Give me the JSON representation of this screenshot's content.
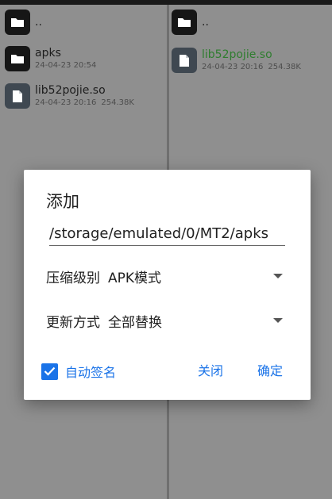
{
  "left_pane": {
    "items": [
      {
        "name": "..",
        "type": "folder",
        "date": "",
        "size": ""
      },
      {
        "name": "apks",
        "type": "folder",
        "date": "24-04-23 20:54",
        "size": ""
      },
      {
        "name": "lib52pojie.so",
        "type": "file",
        "date": "24-04-23 20:16",
        "size": "254.38K"
      }
    ]
  },
  "right_pane": {
    "items": [
      {
        "name": "..",
        "type": "folder",
        "date": "",
        "size": ""
      },
      {
        "name": "lib52pojie.so",
        "type": "file",
        "date": "24-04-23 20:16",
        "size": "254.38K"
      }
    ]
  },
  "dialog": {
    "title": "添加",
    "path_value": "/storage/emulated/0/MT2/apks",
    "compression": {
      "label": "压缩级别",
      "value": "APK模式"
    },
    "update_mode": {
      "label": "更新方式",
      "value": "全部替换"
    },
    "auto_sign": {
      "label": "自动签名",
      "checked": true
    },
    "close_label": "关闭",
    "confirm_label": "确定"
  },
  "colors": {
    "accent": "#1a73e8",
    "highlight_file": "#2f7d2f"
  },
  "icons": {
    "folder": "folder-icon",
    "file": "file-icon",
    "dropdown": "dropdown-arrow-icon",
    "check": "check-icon"
  }
}
